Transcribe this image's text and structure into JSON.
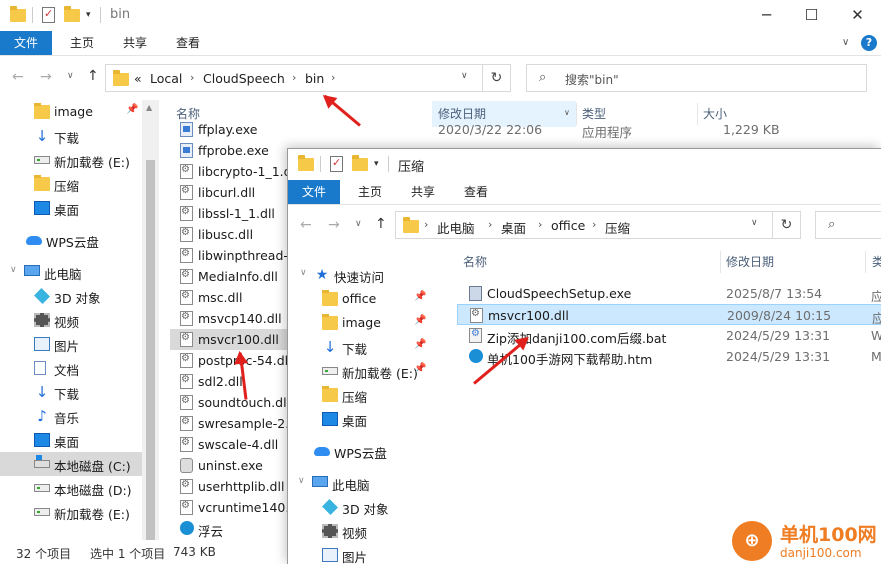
{
  "back_window": {
    "title": "bin",
    "ribbon_tabs": [
      "文件",
      "主页",
      "共享",
      "查看"
    ],
    "breadcrumb": [
      "«",
      "Local",
      "CloudSpeech",
      "bin"
    ],
    "search_placeholder": "搜索\"bin\"",
    "nav_items": [
      {
        "label": "image",
        "icon": "folder-icon",
        "pinned": true
      },
      {
        "label": "下载",
        "icon": "download-icon"
      },
      {
        "label": "新加载卷 (E:)",
        "icon": "drive-icon"
      },
      {
        "label": "压缩",
        "icon": "folder-icon"
      },
      {
        "label": "桌面",
        "icon": "desktop-icon"
      },
      {
        "label": "WPS云盘",
        "icon": "cloud-icon"
      },
      {
        "label": "此电脑",
        "icon": "computer-icon"
      },
      {
        "label": "3D 对象",
        "icon": "3d-objects-icon"
      },
      {
        "label": "视频",
        "icon": "video-icon"
      },
      {
        "label": "图片",
        "icon": "pictures-icon"
      },
      {
        "label": "文档",
        "icon": "documents-icon"
      },
      {
        "label": "下载",
        "icon": "download-icon"
      },
      {
        "label": "音乐",
        "icon": "music-icon"
      },
      {
        "label": "桌面",
        "icon": "desktop-icon"
      },
      {
        "label": "本地磁盘 (C:)",
        "icon": "system-drive-icon",
        "selected": true
      },
      {
        "label": "本地磁盘 (D:)",
        "icon": "drive-icon"
      },
      {
        "label": "新加载卷 (E:)",
        "icon": "drive-icon"
      }
    ],
    "columns": [
      "名称",
      "修改日期",
      "类型",
      "大小"
    ],
    "files": [
      {
        "name": "ffplay.exe",
        "date": "2020/3/22 22:06",
        "type": "应用程序",
        "size": "1,229 KB",
        "icon": "exe"
      },
      {
        "name": "ffprobe.exe",
        "date": "",
        "type": "",
        "size": "",
        "icon": "exe"
      },
      {
        "name": "libcrypto-1_1.dll",
        "icon": "dll"
      },
      {
        "name": "libcurl.dll",
        "icon": "dll"
      },
      {
        "name": "libssl-1_1.dll",
        "icon": "dll"
      },
      {
        "name": "libusc.dll",
        "icon": "dll"
      },
      {
        "name": "libwinpthread-1",
        "icon": "dll"
      },
      {
        "name": "MediaInfo.dll",
        "icon": "dll"
      },
      {
        "name": "msc.dll",
        "icon": "dll"
      },
      {
        "name": "msvcp140.dll",
        "icon": "dll"
      },
      {
        "name": "msvcr100.dll",
        "icon": "dll",
        "selected": true
      },
      {
        "name": "postproc-54.dll",
        "icon": "dll"
      },
      {
        "name": "sdl2.dll",
        "icon": "dll"
      },
      {
        "name": "soundtouch.dll",
        "icon": "dll"
      },
      {
        "name": "swresample-2.d",
        "icon": "dll"
      },
      {
        "name": "swscale-4.dll",
        "icon": "dll"
      },
      {
        "name": "uninst.exe",
        "icon": "uninst"
      },
      {
        "name": "userhttplib.dll",
        "icon": "dll"
      },
      {
        "name": "vcruntime140.d",
        "icon": "dll"
      },
      {
        "name": "浮云",
        "icon": "edge"
      }
    ],
    "status": {
      "count": "32 个项目",
      "selected": "选中 1 个项目",
      "size": "743 KB"
    }
  },
  "front_window": {
    "title": "压缩",
    "ribbon_tabs": [
      "文件",
      "主页",
      "共享",
      "查看"
    ],
    "breadcrumb": [
      "此电脑",
      "桌面",
      "office",
      "压缩"
    ],
    "nav_items": [
      {
        "label": "快速访问",
        "icon": "star-icon"
      },
      {
        "label": "office",
        "icon": "folder-icon",
        "pinned": true
      },
      {
        "label": "image",
        "icon": "folder-icon",
        "pinned": true
      },
      {
        "label": "下载",
        "icon": "download-icon",
        "pinned": true
      },
      {
        "label": "新加载卷 (E:)",
        "icon": "drive-icon",
        "pinned": true
      },
      {
        "label": "压缩",
        "icon": "folder-icon"
      },
      {
        "label": "桌面",
        "icon": "desktop-icon"
      },
      {
        "label": "WPS云盘",
        "icon": "cloud-icon"
      },
      {
        "label": "此电脑",
        "icon": "computer-icon"
      },
      {
        "label": "3D 对象",
        "icon": "3d-objects-icon"
      },
      {
        "label": "视频",
        "icon": "video-icon"
      },
      {
        "label": "图片",
        "icon": "pictures-icon"
      }
    ],
    "columns": [
      "名称",
      "修改日期",
      "类"
    ],
    "files": [
      {
        "name": "CloudSpeechSetup.exe",
        "date": "2025/8/7 13:54",
        "type": "应",
        "icon": "setup"
      },
      {
        "name": "msvcr100.dll",
        "date": "2009/8/24 10:15",
        "type": "应",
        "icon": "dll",
        "selected": true
      },
      {
        "name": "Zip添加danji100.com后缀.bat",
        "date": "2024/5/29 13:31",
        "type": "W",
        "icon": "bat"
      },
      {
        "name": "单机100手游网下载帮助.htm",
        "date": "2024/5/29 13:31",
        "type": "M",
        "icon": "edge"
      }
    ]
  },
  "watermark": {
    "text": "单机100网",
    "url": "danji100.com",
    "icon": "logo-icon"
  },
  "colors": {
    "accent": "#1979ca",
    "selection": "#cce8ff",
    "annotation_arrow": "#e0201c",
    "watermark": "#ef7d23"
  }
}
